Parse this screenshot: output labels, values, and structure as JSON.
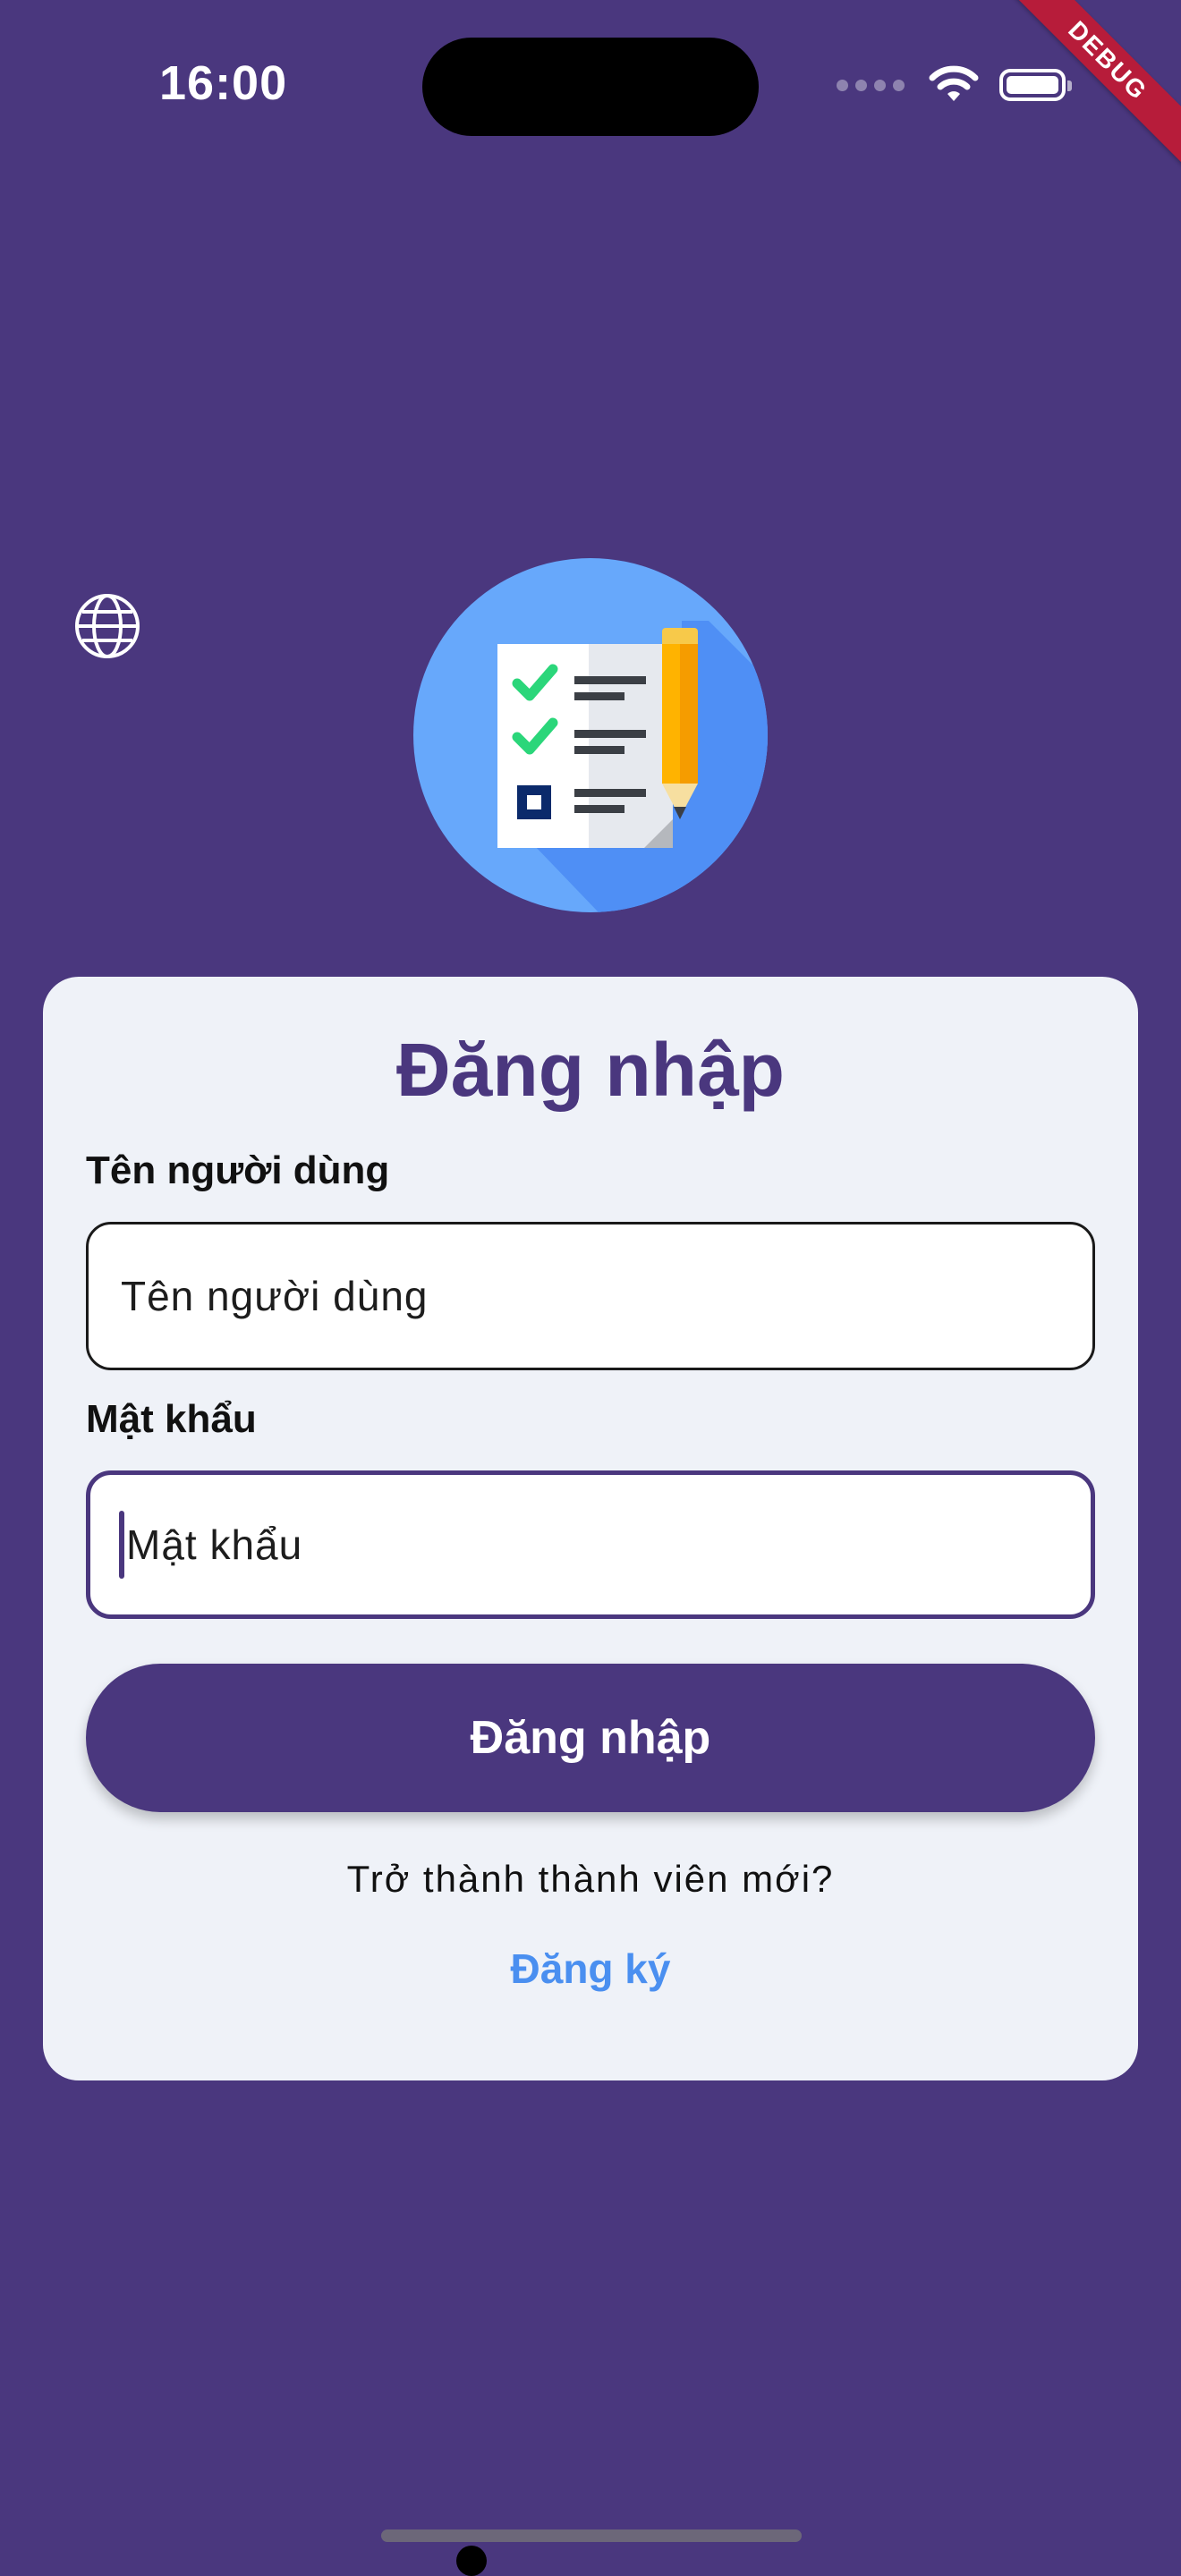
{
  "status_bar": {
    "time": "16:00",
    "icons": [
      "signal-dots-icon",
      "wifi-icon",
      "battery-icon"
    ]
  },
  "debug_banner": "DEBUG",
  "language_button_icon": "globe-icon",
  "logo_icon": "checklist-clipboard-icon",
  "login": {
    "title": "Đăng nhập",
    "username_label": "Tên người dùng",
    "username_placeholder": "Tên người dùng",
    "password_label": "Mật khẩu",
    "password_placeholder": "Mật khẩu",
    "submit_label": "Đăng nhập",
    "signup_prompt": "Trở thành thành viên mới?",
    "signup_link": "Đăng ký"
  },
  "colors": {
    "background": "#4a377e",
    "card": "#eff2f8",
    "primary": "#4a377e",
    "link": "#4a8ff0",
    "logo_circle": "#67a8fb",
    "debug_banner": "#b71c3a"
  }
}
